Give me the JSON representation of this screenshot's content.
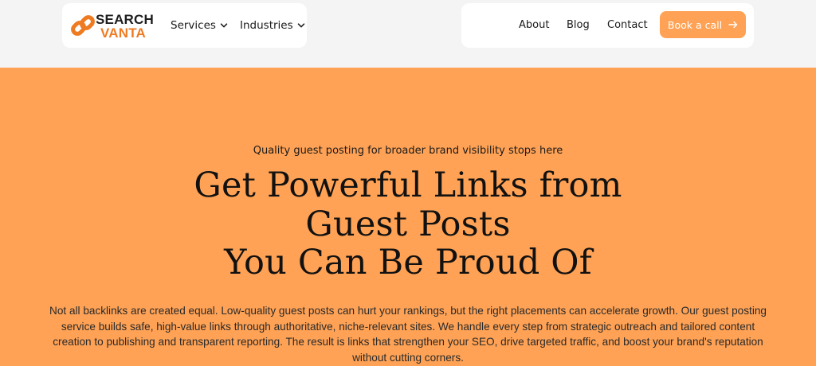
{
  "brand": {
    "line1": "SEARCH",
    "line2": "VANTA",
    "icon": "chain-link-icon",
    "accent": "#ee7b22"
  },
  "nav": {
    "services_label": "Services",
    "industries_label": "Industries",
    "about_label": "About",
    "blog_label": "Blog",
    "contact_label": "Contact",
    "cta_label": "Book a call",
    "cta_icon": "arrow-right-icon"
  },
  "hero": {
    "eyebrow": "Quality guest posting for broader brand visibility stops here",
    "headline_lines": [
      "Get Powerful Links from",
      "Guest Posts",
      "You Can Be Proud Of"
    ],
    "body": "Not all backlinks are created equal. Low-quality guest posts can hurt your rankings, but the right placements can accelerate growth. Our guest posting service builds safe, high-value links through authoritative, niche-relevant sites. We handle every step from strategic outreach and tailored content creation to publishing and transparent reporting. The result is links that strengthen your SEO, drive targeted traffic, and boost your brand's reputation without cutting corners.",
    "background": "#ffa255"
  }
}
